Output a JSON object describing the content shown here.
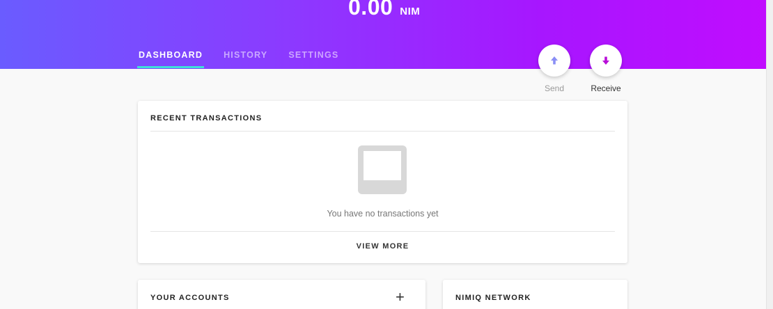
{
  "balance": {
    "amount": "0.00",
    "unit": "NIM"
  },
  "tabs": [
    {
      "label": "DASHBOARD",
      "active": true
    },
    {
      "label": "HISTORY",
      "active": false
    },
    {
      "label": "SETTINGS",
      "active": false
    }
  ],
  "actions": {
    "send": {
      "label": "Send",
      "icon": "arrow-up-icon",
      "color": "#8a8ff5"
    },
    "receive": {
      "label": "Receive",
      "icon": "arrow-down-icon",
      "color": "#b80fd8"
    }
  },
  "recent_transactions": {
    "title": "RECENT TRANSACTIONS",
    "empty_icon": "inbox-icon",
    "empty_message": "You have no transactions yet",
    "view_more_label": "VIEW MORE"
  },
  "accounts": {
    "title": "YOUR ACCOUNTS",
    "add_label": "+"
  },
  "network": {
    "title": "NIMIQ NETWORK"
  },
  "colors": {
    "header_gradient_start": "#6a5cff",
    "header_gradient_end": "#c10cff",
    "tab_indicator": "#3ee0d8"
  }
}
